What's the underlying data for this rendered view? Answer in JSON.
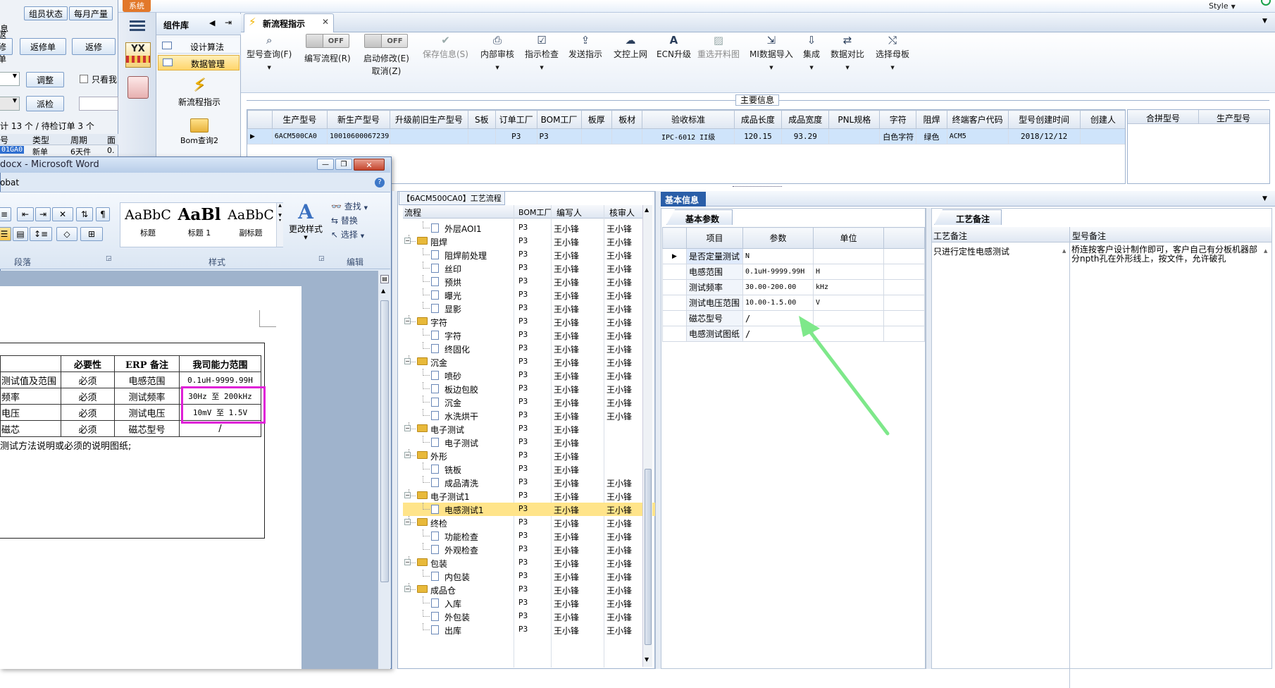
{
  "left_window": {
    "tabs": [
      "组员状态",
      "每月产量"
    ],
    "partial_label": "息",
    "buttons_row1": [
      "返修单",
      "返修"
    ],
    "button_adjust": "调整",
    "checkbox_label": "只看我",
    "button_dispatch": "派检",
    "summary": "计 13 个 / 待检订单 3 个",
    "table_headers": [
      "号",
      "类型",
      "周期",
      "面"
    ],
    "table_row": [
      "01GA0",
      "新单",
      "6天件",
      "0."
    ]
  },
  "word": {
    "title": "docx - Microsoft Word",
    "menu_partial": "obat",
    "styles": [
      {
        "preview": "AaBbC",
        "name": "标题"
      },
      {
        "preview": "AaBl",
        "name": "标题 1"
      },
      {
        "preview": "AaBbC",
        "name": "副标题"
      }
    ],
    "change_styles": "更改样式",
    "edit_items": [
      "查找",
      "替换",
      "选择"
    ],
    "group_labels": [
      "段落",
      "样式",
      "编辑"
    ],
    "table_headers": [
      "必要性",
      "ERP 备注",
      "我司能力范围"
    ],
    "table_rows": [
      [
        "测试值及范围",
        "必须",
        "电感范围",
        "0.1uH-9999.99H"
      ],
      [
        "频率",
        "必须",
        "测试频率",
        "30Hz 至 200kHz"
      ],
      [
        "电压",
        "必须",
        "测试电压",
        "10mV 至 1.5V"
      ],
      [
        "磁芯",
        "必须",
        "磁芯型号",
        "/"
      ]
    ],
    "note": "测试方法说明或必须的说明图纸;"
  },
  "app": {
    "system_tab": "系统",
    "style_label": "Style",
    "component_panel_title": "组件库",
    "nav_items": [
      "设计算法",
      "数据管理"
    ],
    "launchers": [
      "新流程指示",
      "Bom查询2"
    ],
    "doc_tab": "新流程指示",
    "toolbar": [
      {
        "label": "型号查询(F)",
        "icon": "search-icon"
      },
      {
        "label": "编写流程(R)",
        "icon": "toggle-off"
      },
      {
        "label": "启动修改(E)",
        "sub": "取消(Z)",
        "icon": "toggle-off"
      },
      {
        "label": "保存信息(S)",
        "icon": "check-icon",
        "disabled": true
      },
      {
        "label": "内部审核",
        "icon": "print-icon"
      },
      {
        "label": "指示检查",
        "icon": "check-box-icon"
      },
      {
        "label": "发送指示",
        "icon": "upload-icon"
      },
      {
        "label": "文控上网",
        "icon": "cloud-icon"
      },
      {
        "label": "ECN升级",
        "icon": "ecn-icon"
      },
      {
        "label": "重选开料图",
        "icon": "image-icon",
        "disabled": true
      },
      {
        "label": "MI数据导入",
        "icon": "import-icon"
      },
      {
        "label": "集成",
        "icon": "download-icon"
      },
      {
        "label": "数据对比",
        "icon": "compare-icon"
      },
      {
        "label": "选择母板",
        "icon": "shuffle-icon"
      }
    ],
    "toggle_text": "OFF",
    "main_info_label": "主要信息",
    "main_table": {
      "headers": [
        "生产型号",
        "新生产型号",
        "升级前旧生产型号",
        "S板",
        "订单工厂",
        "BOM工厂",
        "板厚",
        "板材",
        "验收标准",
        "成品长度",
        "成品宽度",
        "PNL规格",
        "字符",
        "阻焊",
        "终端客户代码",
        "型号创建时间",
        "创建人"
      ],
      "row": [
        "6ACM500CA0",
        "10010600067239",
        "",
        "",
        "P3",
        "P3",
        "",
        "",
        "IPC-6012 II级",
        "120.15",
        "93.29",
        "",
        "白色字符",
        "绿色",
        "ACM5",
        "2018/12/12",
        ""
      ]
    },
    "merge_headers": [
      "合拼型号",
      "生产型号"
    ],
    "process_panel": {
      "title": "【6ACM500CA0】工艺流程",
      "headers": [
        "流程",
        "BOM工厂",
        "编写人",
        "核审人"
      ],
      "rows": [
        {
          "name": "外层AOI1",
          "level": 2,
          "bom": "P3",
          "writer": "王小锋",
          "reviewer": "王小锋"
        },
        {
          "name": "阻焊",
          "level": 1,
          "bom": "P3",
          "writer": "王小锋",
          "reviewer": "王小锋"
        },
        {
          "name": "阻焊前处理",
          "level": 2,
          "bom": "P3",
          "writer": "王小锋",
          "reviewer": "王小锋"
        },
        {
          "name": "丝印",
          "level": 2,
          "bom": "P3",
          "writer": "王小锋",
          "reviewer": "王小锋"
        },
        {
          "name": "预烘",
          "level": 2,
          "bom": "P3",
          "writer": "王小锋",
          "reviewer": "王小锋"
        },
        {
          "name": "曝光",
          "level": 2,
          "bom": "P3",
          "writer": "王小锋",
          "reviewer": "王小锋"
        },
        {
          "name": "显影",
          "level": 2,
          "bom": "P3",
          "writer": "王小锋",
          "reviewer": "王小锋"
        },
        {
          "name": "字符",
          "level": 1,
          "bom": "P3",
          "writer": "王小锋",
          "reviewer": "王小锋"
        },
        {
          "name": "字符",
          "level": 2,
          "bom": "P3",
          "writer": "王小锋",
          "reviewer": "王小锋"
        },
        {
          "name": "终固化",
          "level": 2,
          "bom": "P3",
          "writer": "王小锋",
          "reviewer": "王小锋"
        },
        {
          "name": "沉金",
          "level": 1,
          "bom": "P3",
          "writer": "王小锋",
          "reviewer": "王小锋"
        },
        {
          "name": "喷砂",
          "level": 2,
          "bom": "P3",
          "writer": "王小锋",
          "reviewer": "王小锋"
        },
        {
          "name": "板边包胶",
          "level": 2,
          "bom": "P3",
          "writer": "王小锋",
          "reviewer": "王小锋"
        },
        {
          "name": "沉金",
          "level": 2,
          "bom": "P3",
          "writer": "王小锋",
          "reviewer": "王小锋"
        },
        {
          "name": "水洗烘干",
          "level": 2,
          "bom": "P3",
          "writer": "王小锋",
          "reviewer": "王小锋"
        },
        {
          "name": "电子测试",
          "level": 1,
          "bom": "P3",
          "writer": "王小锋",
          "reviewer": ""
        },
        {
          "name": "电子测试",
          "level": 2,
          "bom": "P3",
          "writer": "王小锋",
          "reviewer": ""
        },
        {
          "name": "外形",
          "level": 1,
          "bom": "P3",
          "writer": "王小锋",
          "reviewer": ""
        },
        {
          "name": "铣板",
          "level": 2,
          "bom": "P3",
          "writer": "王小锋",
          "reviewer": ""
        },
        {
          "name": "成品清洗",
          "level": 2,
          "bom": "P3",
          "writer": "王小锋",
          "reviewer": "王小锋"
        },
        {
          "name": "电子测试1",
          "level": 1,
          "bom": "P3",
          "writer": "王小锋",
          "reviewer": "王小锋"
        },
        {
          "name": "电感测试1",
          "level": 2,
          "bom": "P3",
          "writer": "王小锋",
          "reviewer": "王小锋",
          "selected": true
        },
        {
          "name": "终检",
          "level": 1,
          "bom": "P3",
          "writer": "王小锋",
          "reviewer": "王小锋"
        },
        {
          "name": "功能检查",
          "level": 2,
          "bom": "P3",
          "writer": "王小锋",
          "reviewer": "王小锋"
        },
        {
          "name": "外观检查",
          "level": 2,
          "bom": "P3",
          "writer": "王小锋",
          "reviewer": "王小锋"
        },
        {
          "name": "包装",
          "level": 1,
          "bom": "P3",
          "writer": "王小锋",
          "reviewer": "王小锋"
        },
        {
          "name": "内包装",
          "level": 2,
          "bom": "P3",
          "writer": "王小锋",
          "reviewer": "王小锋"
        },
        {
          "name": "成品仓",
          "level": 1,
          "bom": "P3",
          "writer": "王小锋",
          "reviewer": "王小锋"
        },
        {
          "name": "入库",
          "level": 2,
          "bom": "P3",
          "writer": "王小锋",
          "reviewer": "王小锋"
        },
        {
          "name": "外包装",
          "level": 2,
          "bom": "P3",
          "writer": "王小锋",
          "reviewer": "王小锋"
        },
        {
          "name": "出库",
          "level": 2,
          "bom": "P3",
          "writer": "王小锋",
          "reviewer": "王小锋"
        }
      ]
    },
    "basic_info": {
      "title": "基本信息",
      "tab": "基本参数",
      "headers": [
        "项目",
        "参数",
        "单位"
      ],
      "rows": [
        [
          "是否定量测试",
          "N",
          ""
        ],
        [
          "电感范围",
          "0.1uH-9999.99H",
          "H"
        ],
        [
          "测试频率",
          "30.00-200.00",
          "kHz"
        ],
        [
          "测试电压范围",
          "10.00-1.5.00",
          "V"
        ],
        [
          "磁芯型号",
          "/",
          ""
        ],
        [
          "电感测试图纸",
          "/",
          ""
        ]
      ]
    },
    "process_notes": {
      "tab": "工艺备注",
      "headers": [
        "工艺备注",
        "型号备注"
      ],
      "process_note": "只进行定性电感测试",
      "model_note": "桥连按客户设计制作即可，客户自己有分板机器部分npth孔在外形线上，按文件，允许破孔"
    }
  },
  "colors": {
    "highlight_box": "#e020d8",
    "arrow": "#7ee88a",
    "panel_header_blue": "#2a5ea8",
    "selected_row": "#ffe48a"
  }
}
